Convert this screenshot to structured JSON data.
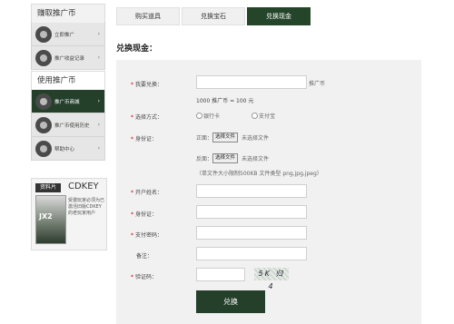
{
  "sidebar": {
    "earn_header": "赚取推广币",
    "use_header": "使用推广币",
    "items_earn": [
      {
        "label": "立即推广",
        "icon": "promote-icon"
      },
      {
        "label": "推广收益记录",
        "icon": "record-icon"
      }
    ],
    "items_use": [
      {
        "label": "推广币商城",
        "icon": "shop-icon",
        "active": true
      },
      {
        "label": "推广币使用历史",
        "icon": "history-icon"
      },
      {
        "label": "帮助中心",
        "icon": "help-icon"
      }
    ],
    "promo": {
      "tag": "资料片",
      "title": "CDKEY",
      "box_text": "JX2",
      "text": "受邀玩家必须为已激活旧版CDKEY的老玩家用户"
    }
  },
  "tabs": [
    {
      "label": "购买道具"
    },
    {
      "label": "兑换宝石"
    },
    {
      "label": "兑换现金",
      "active": true
    }
  ],
  "section_title": "兑换现金：",
  "form": {
    "amount_label": "我要兑换：",
    "amount_unit": "推广币",
    "rate": "1000 推广币 = 100 元",
    "method_label": "选择方式：",
    "method_opt1": "银行卡",
    "method_opt2": "支付宝",
    "id_label": "身份证：",
    "front_label": "正面：",
    "back_label": "反面：",
    "choose_file": "选择文件",
    "no_file": "未选择文件",
    "file_hint": "（单文件大小限制500KB 文件类型 png,jpg,jpeg）",
    "account_name_label": "开户姓名：",
    "id2_label": "身份证：",
    "pay_pwd_label": "支付密码：",
    "note_label": "备注：",
    "captcha_label": "验证码：",
    "captcha_text": "5K 归 4",
    "submit": "兑换"
  },
  "colors": {
    "accent": "#244529"
  }
}
